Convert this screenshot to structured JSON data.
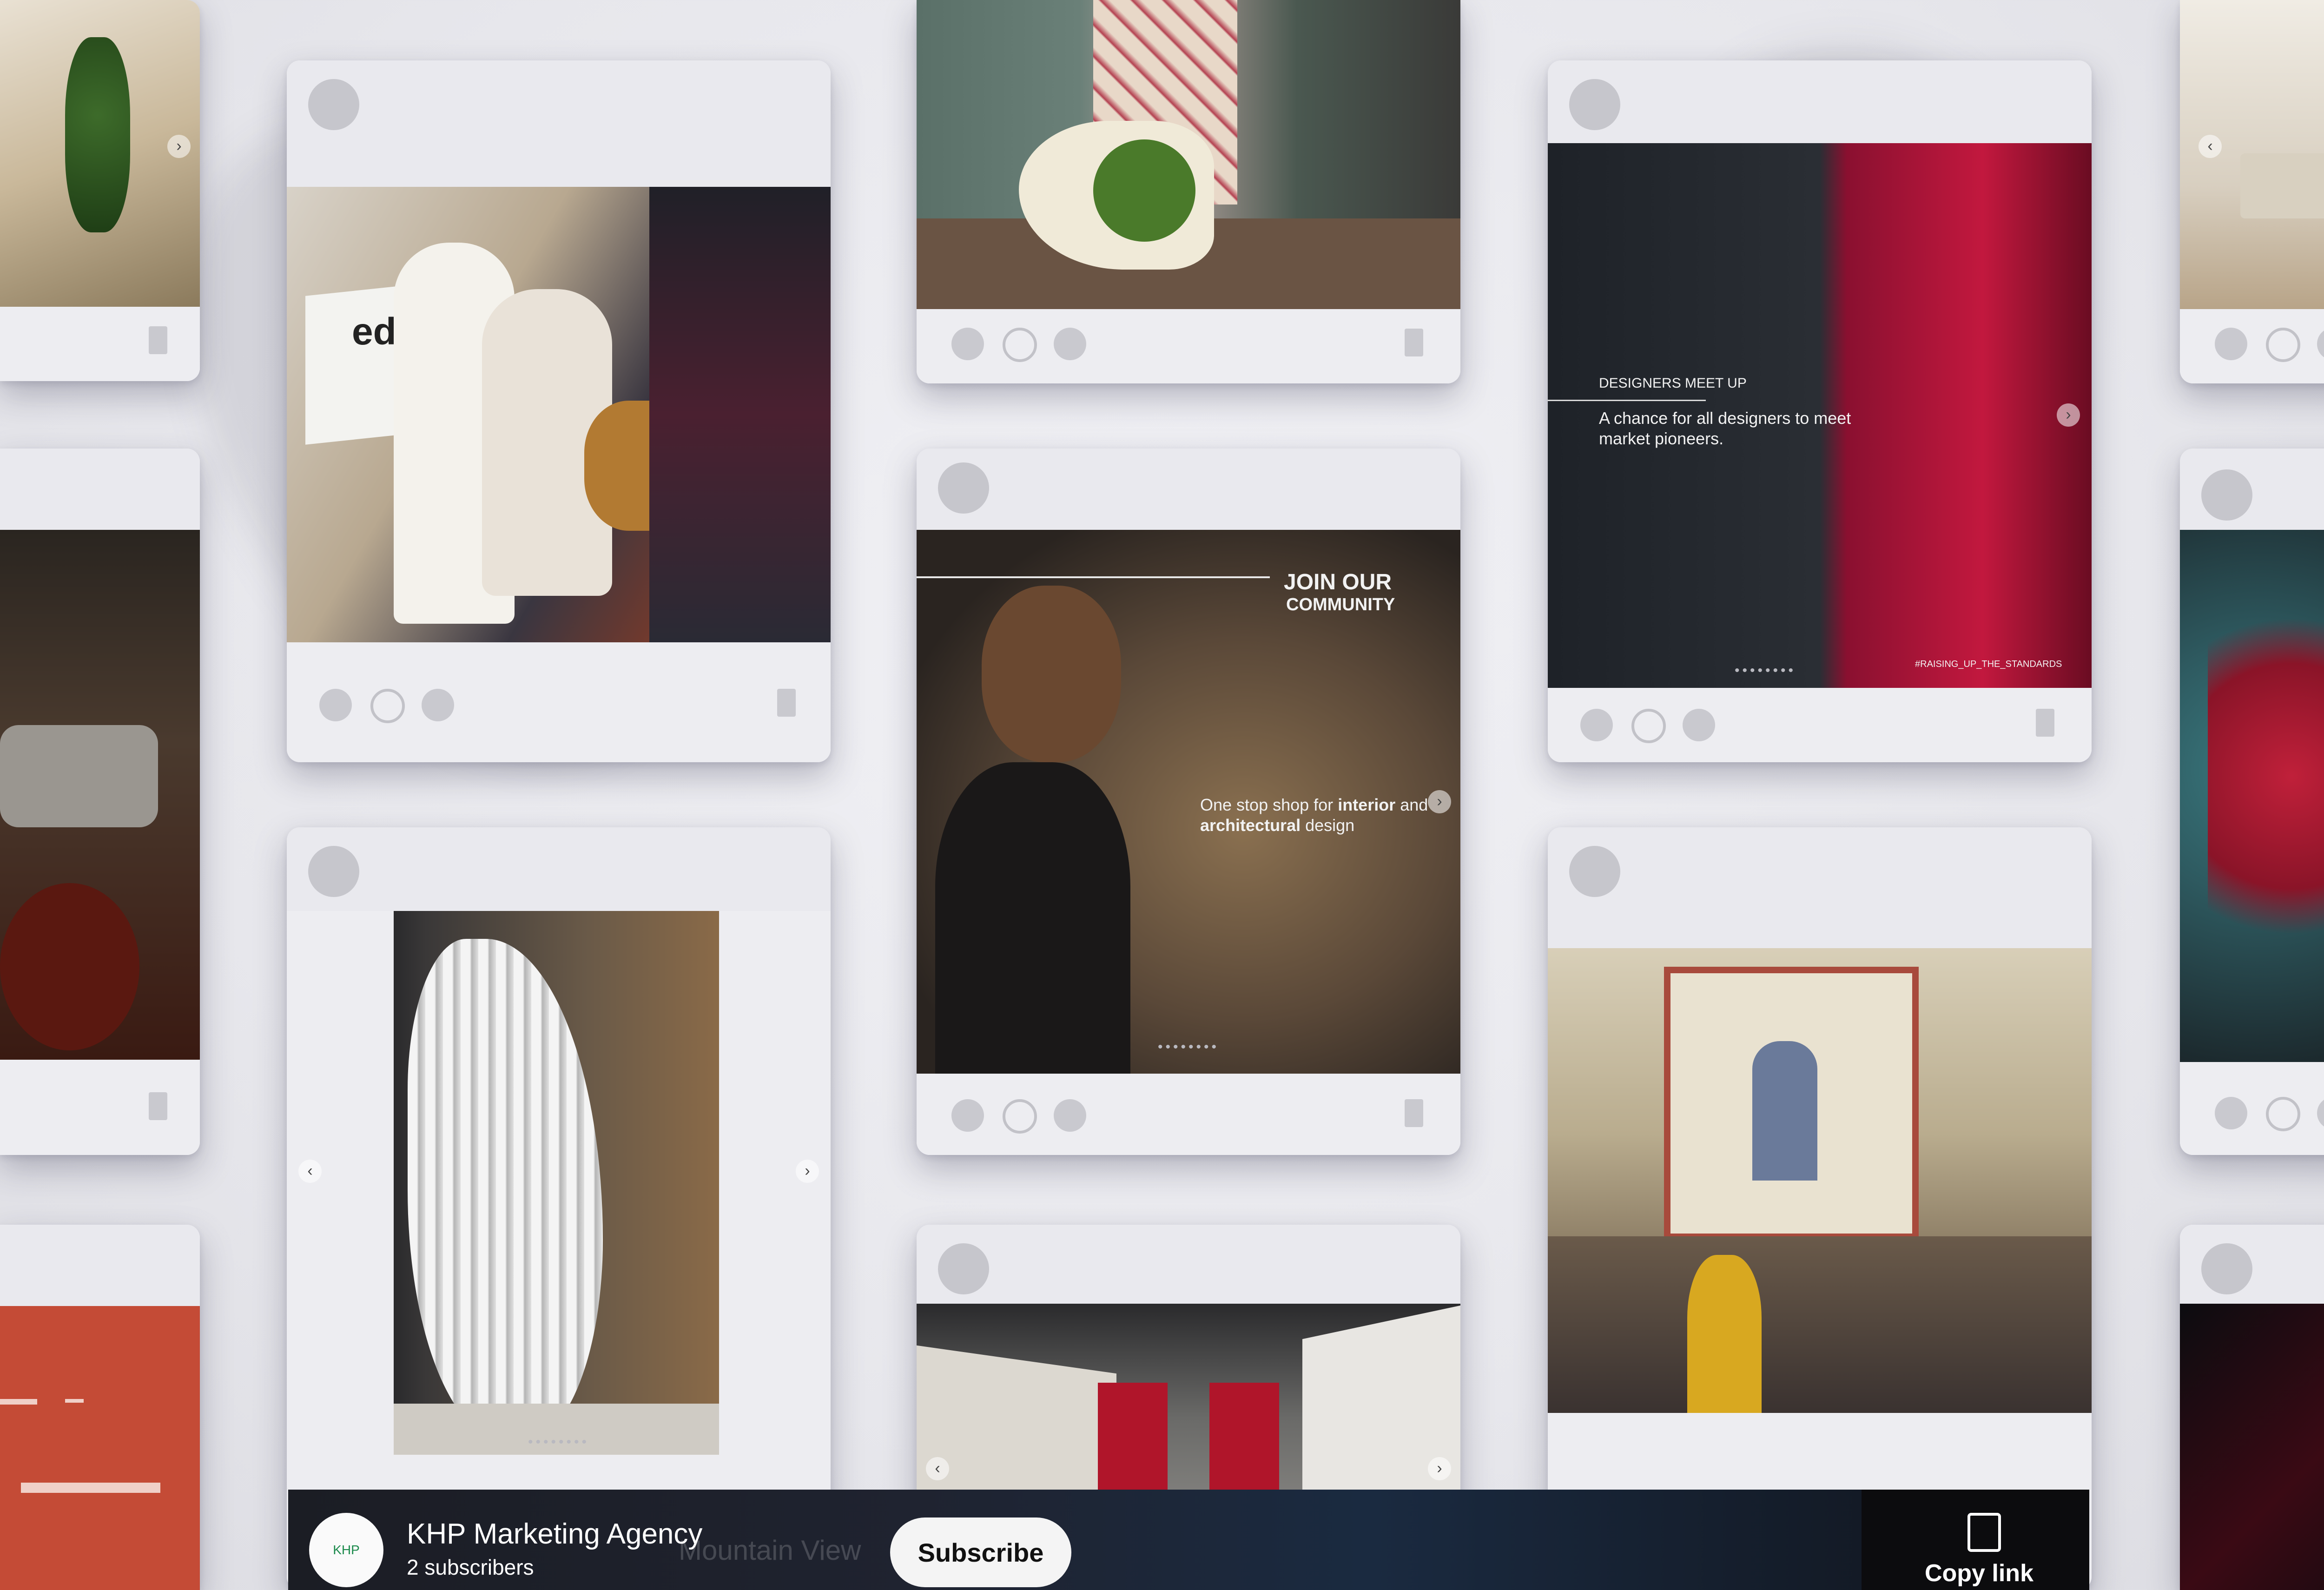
{
  "posts": {
    "edra": {
      "brand_text": "edra"
    },
    "join": {
      "heading_line1": "JOIN OUR",
      "heading_line2": "COMMUNITY",
      "body_normal": "One stop shop for ",
      "body_bold1": "interior",
      "body_mid": " and",
      "body_bold2": "architectural",
      "body_end": " design",
      "pager": "••••••••"
    },
    "designers": {
      "heading": "DESIGNERS MEET UP",
      "body": "A chance for all designers to meet market pioneers.",
      "hashtag": "#RAISING_UP_THE_STANDARDS",
      "pager": "••••••••"
    },
    "sculpture": {
      "pager": "••••••••"
    }
  },
  "youtube": {
    "channel_name": "KHP Marketing Agency",
    "subscribers": "2 subscribers",
    "ghost_title": "Mountain View",
    "subscribe_label": "Subscribe",
    "copy_link_label": "Copy link",
    "logo_text": "KHP"
  },
  "colors": {
    "background": "#e7e7ec",
    "card": "#ededf1",
    "accent_red": "#c2183e",
    "teal": "#2e8a92"
  }
}
